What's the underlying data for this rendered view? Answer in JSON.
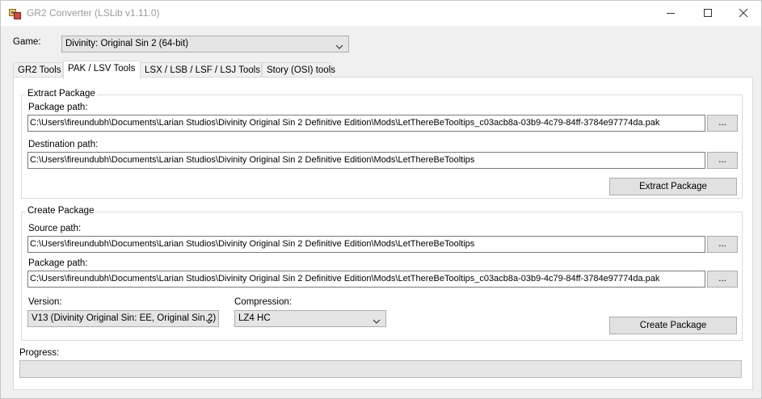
{
  "window": {
    "title": "GR2 Converter (LSLib v1.11.0)"
  },
  "game": {
    "label": "Game:",
    "selected": "Divinity: Original Sin 2 (64-bit)"
  },
  "tabs": [
    {
      "label": "GR2 Tools",
      "active": false
    },
    {
      "label": "PAK / LSV Tools",
      "active": true
    },
    {
      "label": "LSX / LSB / LSF / LSJ Tools",
      "active": false
    },
    {
      "label": "Story (OSI) tools",
      "active": false
    }
  ],
  "extract": {
    "group_title": "Extract Package",
    "package_label": "Package path:",
    "package_value": "C:\\Users\\fireundubh\\Documents\\Larian Studios\\Divinity Original Sin 2 Definitive Edition\\Mods\\LetThereBeTooltips_c03acb8a-03b9-4c79-84ff-3784e97774da.pak",
    "destination_label": "Destination path:",
    "destination_value": "C:\\Users\\fireundubh\\Documents\\Larian Studios\\Divinity Original Sin 2 Definitive Edition\\Mods\\LetThereBeTooltips",
    "browse_label": "...",
    "button_label": "Extract Package"
  },
  "create": {
    "group_title": "Create Package",
    "source_label": "Source path:",
    "source_value": "C:\\Users\\fireundubh\\Documents\\Larian Studios\\Divinity Original Sin 2 Definitive Edition\\Mods\\LetThereBeTooltips",
    "package_label": "Package path:",
    "package_value": "C:\\Users\\fireundubh\\Documents\\Larian Studios\\Divinity Original Sin 2 Definitive Edition\\Mods\\LetThereBeTooltips_c03acb8a-03b9-4c79-84ff-3784e97774da.pak",
    "browse_label": "...",
    "version_label": "Version:",
    "version_selected": "V13 (Divinity Original Sin: EE, Original Sin 2)",
    "compression_label": "Compression:",
    "compression_selected": "LZ4 HC",
    "button_label": "Create Package"
  },
  "progress": {
    "label": "Progress:",
    "value": 0
  },
  "icons": [
    "app-icon",
    "minimize-icon",
    "maximize-icon",
    "close-icon",
    "chevron-down-icon"
  ]
}
